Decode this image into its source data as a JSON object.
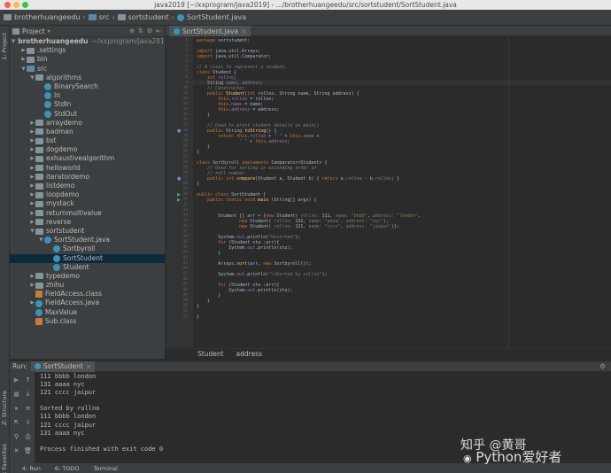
{
  "window": {
    "title": "java2019 [~/xxprogram/java2019] - .../brotherhuangeedu/src/sortstudent/SortStudent.java"
  },
  "nav": {
    "items": [
      "brotherhuangeedu",
      "src",
      "sortstudent",
      "SortStudent.java"
    ]
  },
  "toolstrip": {
    "project": "1: Project",
    "structure": "Z: Structure",
    "favorites": "2: Favorites"
  },
  "project": {
    "header": "Project",
    "tree": [
      {
        "label": "brotherhuangeedu",
        "suffix": "~/xxprogram/java2019",
        "depth": 0,
        "icon": "folder",
        "expanded": "open",
        "bold": true
      },
      {
        "label": ".settings",
        "depth": 1,
        "icon": "folder",
        "expanded": "closed"
      },
      {
        "label": "bin",
        "depth": 1,
        "icon": "folder",
        "expanded": "closed"
      },
      {
        "label": "src",
        "depth": 1,
        "icon": "src",
        "expanded": "open"
      },
      {
        "label": "algorithms",
        "depth": 2,
        "icon": "folder",
        "expanded": "open"
      },
      {
        "label": "BinarySearch",
        "depth": 3,
        "icon": "class"
      },
      {
        "label": "In",
        "depth": 3,
        "icon": "class"
      },
      {
        "label": "StdIn",
        "depth": 3,
        "icon": "class"
      },
      {
        "label": "StdOut",
        "depth": 3,
        "icon": "class"
      },
      {
        "label": "arraydemo",
        "depth": 2,
        "icon": "folder",
        "expanded": "closed"
      },
      {
        "label": "badman",
        "depth": 2,
        "icon": "folder",
        "expanded": "closed"
      },
      {
        "label": "bst",
        "depth": 2,
        "icon": "folder",
        "expanded": "closed"
      },
      {
        "label": "dogdemo",
        "depth": 2,
        "icon": "folder",
        "expanded": "closed"
      },
      {
        "label": "exhaustivealgorithm",
        "depth": 2,
        "icon": "folder",
        "expanded": "closed"
      },
      {
        "label": "helloworld",
        "depth": 2,
        "icon": "folder",
        "expanded": "closed"
      },
      {
        "label": "iteratordemo",
        "depth": 2,
        "icon": "folder",
        "expanded": "closed"
      },
      {
        "label": "listdemo",
        "depth": 2,
        "icon": "folder",
        "expanded": "closed"
      },
      {
        "label": "loopdemo",
        "depth": 2,
        "icon": "folder",
        "expanded": "closed"
      },
      {
        "label": "mystack",
        "depth": 2,
        "icon": "folder",
        "expanded": "closed"
      },
      {
        "label": "returnmultivalue",
        "depth": 2,
        "icon": "folder",
        "expanded": "closed"
      },
      {
        "label": "reverse",
        "depth": 2,
        "icon": "folder",
        "expanded": "closed"
      },
      {
        "label": "sortstudent",
        "depth": 2,
        "icon": "folder",
        "expanded": "open"
      },
      {
        "label": "SortStudent.java",
        "depth": 3,
        "icon": "class",
        "expanded": "open"
      },
      {
        "label": "Sortbyroll",
        "depth": 4,
        "icon": "class"
      },
      {
        "label": "SortStudent",
        "depth": 4,
        "icon": "class",
        "selected": true
      },
      {
        "label": "Student",
        "depth": 4,
        "icon": "class"
      },
      {
        "label": "typedemo",
        "depth": 2,
        "icon": "folder",
        "expanded": "closed"
      },
      {
        "label": "zhihu",
        "depth": 2,
        "icon": "folder",
        "expanded": "closed"
      },
      {
        "label": "FieldAccess.class",
        "depth": 2,
        "icon": "java"
      },
      {
        "label": "FieldAccess.java",
        "depth": 2,
        "icon": "class",
        "expanded": "closed"
      },
      {
        "label": "MaxValue",
        "depth": 2,
        "icon": "class"
      },
      {
        "label": "Sub.class",
        "depth": 2,
        "icon": "java"
      }
    ]
  },
  "editor": {
    "tab": "SortStudent.java",
    "line_numbers": [
      "1",
      "2",
      "3",
      "4",
      "5",
      "6",
      "7",
      "8",
      "9",
      "10",
      "11",
      "12",
      "13",
      "14",
      "15",
      "16",
      "17",
      "18",
      "19",
      "20",
      "21",
      "22",
      "23",
      "24",
      "25",
      "26",
      "27",
      "28",
      "29",
      "30",
      "31",
      "32",
      "33",
      "34",
      "35",
      "36",
      "37",
      "38",
      "39",
      "40",
      "41",
      "42",
      "43",
      "44",
      "45",
      "46",
      "47",
      "48",
      "49",
      "50",
      "51",
      "52",
      "53"
    ],
    "code": [
      [
        [
          "kw",
          "package "
        ],
        [
          "",
          "sortstudent;"
        ]
      ],
      [],
      [
        [
          "kw",
          "import "
        ],
        [
          "",
          "java.util.Arrays;"
        ]
      ],
      [
        [
          "kw",
          "import "
        ],
        [
          "",
          "java.util.Comparator;"
        ]
      ],
      [],
      [
        [
          "cm",
          "// A class to represent a student."
        ]
      ],
      [
        [
          "kw",
          "class "
        ],
        [
          "",
          "Student {"
        ]
      ],
      [
        [
          "",
          "    "
        ],
        [
          "kw",
          "int "
        ],
        [
          "fd",
          "rollno"
        ],
        [
          "",
          ";"
        ]
      ],
      [
        [
          "",
          "    String "
        ],
        [
          "fd",
          "name"
        ],
        [
          "",
          ", "
        ],
        [
          "fd",
          "address"
        ],
        [
          "",
          ";"
        ]
      ],
      [
        [
          "cm",
          "    // Constructor"
        ]
      ],
      [
        [
          "",
          "    "
        ],
        [
          "kw",
          "public "
        ],
        [
          "fn",
          "Student"
        ],
        [
          "",
          "("
        ],
        [
          "kw",
          "int "
        ],
        [
          "",
          "rollno, String name, String address) {"
        ]
      ],
      [
        [
          "",
          "        "
        ],
        [
          "kw",
          "this"
        ],
        [
          "",
          "."
        ],
        [
          "fd",
          "rollno"
        ],
        [
          "",
          " = rollno;"
        ]
      ],
      [
        [
          "",
          "        "
        ],
        [
          "kw",
          "this"
        ],
        [
          "",
          "."
        ],
        [
          "fd",
          "name"
        ],
        [
          "",
          " = name;"
        ]
      ],
      [
        [
          "",
          "        "
        ],
        [
          "kw",
          "this"
        ],
        [
          "",
          "."
        ],
        [
          "fd",
          "address"
        ],
        [
          "",
          " = address;"
        ]
      ],
      [
        [
          "",
          "    }"
        ]
      ],
      [],
      [
        [
          "cm",
          "    // Used to print student details in main()"
        ]
      ],
      [
        [
          "",
          "    "
        ],
        [
          "kw",
          "public "
        ],
        [
          "",
          "String "
        ],
        [
          "fn",
          "toString"
        ],
        [
          "",
          "() {"
        ]
      ],
      [
        [
          "",
          "        "
        ],
        [
          "kw",
          "return this"
        ],
        [
          "",
          "."
        ],
        [
          "fd",
          "rollno"
        ],
        [
          "",
          " + "
        ],
        [
          "st",
          "\" \""
        ],
        [
          "",
          " + "
        ],
        [
          "kw",
          "this"
        ],
        [
          "",
          "."
        ],
        [
          "fd",
          "name"
        ],
        [
          "",
          " +"
        ]
      ],
      [
        [
          "",
          "                "
        ],
        [
          "st",
          "\" \""
        ],
        [
          "",
          " + "
        ],
        [
          "kw",
          "this"
        ],
        [
          "",
          "."
        ],
        [
          "fd",
          "address"
        ],
        [
          "",
          ";"
        ]
      ],
      [
        [
          "",
          "    }"
        ]
      ],
      [
        [
          "",
          "}"
        ]
      ],
      [],
      [
        [
          "kw",
          "class "
        ],
        [
          "",
          "Sortbyroll "
        ],
        [
          "kw",
          "implements "
        ],
        [
          "",
          "Comparator<Student> {"
        ]
      ],
      [
        [
          "cm",
          "    // Used for sorting in ascending order of"
        ]
      ],
      [
        [
          "cm",
          "    // roll number"
        ]
      ],
      [
        [
          "",
          "    "
        ],
        [
          "kw",
          "public int "
        ],
        [
          "fn",
          "compare"
        ],
        [
          "",
          "(Student a, Student b) { "
        ],
        [
          "kw",
          "return "
        ],
        [
          "",
          "a."
        ],
        [
          "fd",
          "rollno"
        ],
        [
          "",
          " - b."
        ],
        [
          "fd",
          "rollno"
        ],
        [
          "",
          "; }"
        ]
      ],
      [
        [
          "",
          "}"
        ]
      ],
      [],
      [
        [
          "kw",
          "public class "
        ],
        [
          "",
          "SortStudent {"
        ]
      ],
      [
        [
          "",
          "    "
        ],
        [
          "kw",
          "public static void "
        ],
        [
          "fn",
          "main"
        ],
        [
          "",
          " (String[] args) {"
        ]
      ],
      [],
      [],
      [
        [
          "",
          "        Student [] arr = {"
        ],
        [
          "kw",
          "new "
        ],
        [
          "",
          "Student( "
        ],
        [
          "an",
          "rollno: "
        ],
        [
          "",
          "111, "
        ],
        [
          "an",
          "name: "
        ],
        [
          "st",
          "\"bbbb\""
        ],
        [
          "",
          ", "
        ],
        [
          "an",
          "address: "
        ],
        [
          "st",
          "\"london\""
        ],
        [
          "",
          ","
        ]
      ],
      [
        [
          "",
          "                "
        ],
        [
          "kw",
          "new "
        ],
        [
          "",
          "Student( "
        ],
        [
          "an",
          "rollno: "
        ],
        [
          "",
          "131, "
        ],
        [
          "an",
          "name: "
        ],
        [
          "st",
          "\"aaaa\""
        ],
        [
          "",
          ", "
        ],
        [
          "an",
          "address: "
        ],
        [
          "st",
          "\"nyc\""
        ],
        [
          "",
          "),"
        ]
      ],
      [
        [
          "",
          "                "
        ],
        [
          "kw",
          "new "
        ],
        [
          "",
          "Student( "
        ],
        [
          "an",
          "rollno: "
        ],
        [
          "",
          "121, "
        ],
        [
          "an",
          "name: "
        ],
        [
          "st",
          "\"cccc\""
        ],
        [
          "",
          ", "
        ],
        [
          "an",
          "address: "
        ],
        [
          "st",
          "\"jaipur\""
        ],
        [
          "",
          ")};"
        ]
      ],
      [],
      [
        [
          "",
          "        System."
        ],
        [
          "fd",
          "out"
        ],
        [
          "",
          ".println("
        ],
        [
          "st",
          "\"Unsorted\""
        ],
        [
          "",
          ");"
        ]
      ],
      [
        [
          "",
          "        "
        ],
        [
          "kw",
          "for "
        ],
        [
          "",
          "(Student stu :arr){"
        ]
      ],
      [
        [
          "",
          "            System."
        ],
        [
          "fd",
          "out"
        ],
        [
          "",
          ".println(stu);"
        ]
      ],
      [
        [
          "",
          "        }"
        ]
      ],
      [],
      [
        [
          "",
          "        Arrays."
        ],
        [
          "fn",
          "sort"
        ],
        [
          "",
          "(arr, "
        ],
        [
          "kw",
          "new "
        ],
        [
          "",
          "Sortbyroll());"
        ]
      ],
      [],
      [
        [
          "",
          "        System."
        ],
        [
          "fd",
          "out"
        ],
        [
          "",
          ".println("
        ],
        [
          "st",
          "\"\\nSorted by rollno\""
        ],
        [
          "",
          ");"
        ]
      ],
      [],
      [
        [
          "",
          "        "
        ],
        [
          "kw",
          "for "
        ],
        [
          "",
          "(Student stu :arr){"
        ]
      ],
      [
        [
          "",
          "            System."
        ],
        [
          "fd",
          "out"
        ],
        [
          "",
          ".println(stu);"
        ]
      ],
      [
        [
          "",
          "        }"
        ]
      ],
      [
        [
          "",
          "    }"
        ]
      ],
      [
        [
          "",
          "}"
        ]
      ],
      [],
      [
        [
          "",
          "}"
        ]
      ]
    ],
    "breadcrumb": [
      "Student",
      "address"
    ]
  },
  "run": {
    "label": "Run:",
    "tab": "SortStudent",
    "output": [
      "111 bbbb london",
      "131 aaaa nyc",
      "121 cccc jaipur",
      "",
      "Sorted by rollno",
      "111 bbbb london",
      "121 cccc jaipur",
      "131 aaaa nyc",
      "",
      "Process finished with exit code 0"
    ]
  },
  "bottombar": {
    "run": "4: Run",
    "todo": "6: TODO",
    "terminal": "Terminal"
  },
  "watermark": {
    "line1": "知乎 @黄哥",
    "line2": "Python爱好者"
  },
  "colors": {
    "bg": "#2b2b2b",
    "panel": "#3c3f41",
    "selection": "#0d293e",
    "keyword": "#cc7832",
    "string": "#6a8759",
    "comment": "#808080",
    "field": "#9876aa",
    "method": "#ffc66d"
  }
}
